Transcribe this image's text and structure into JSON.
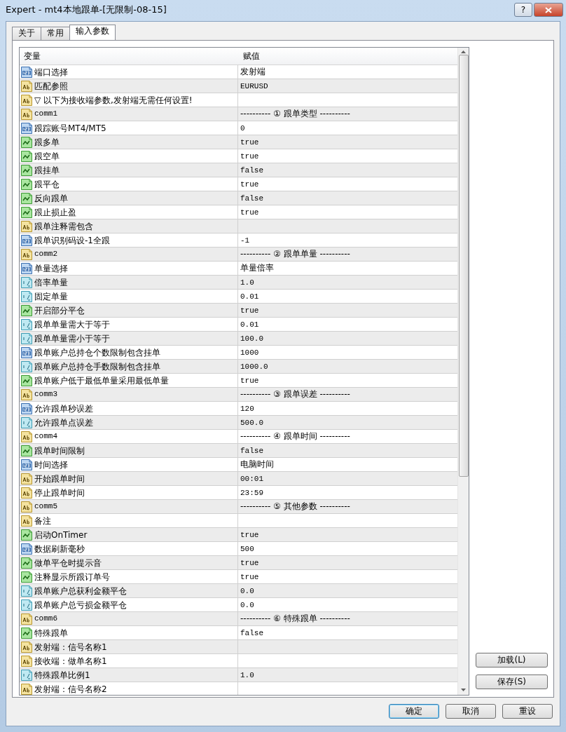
{
  "window": {
    "title": "Expert - mt4本地跟单-[无限制-08-15]",
    "help_button": "?"
  },
  "tabs": [
    {
      "label": "关于",
      "selected": false
    },
    {
      "label": "常用",
      "selected": false
    },
    {
      "label": "输入参数",
      "selected": true
    }
  ],
  "table": {
    "columns": [
      "变量",
      "赋值"
    ],
    "rows": [
      {
        "kind": "int",
        "variable": "端口选择",
        "value": "发射端"
      },
      {
        "kind": "string",
        "variable": "匹配参照",
        "value": "EURUSD"
      },
      {
        "kind": "string",
        "variable": "▽ 以下为接收端参数,发射端无需任何设置!",
        "value": ""
      },
      {
        "kind": "string",
        "variable": "comm1",
        "value": "---------- ① 跟单类型 ----------"
      },
      {
        "kind": "int",
        "variable": "跟踪账号MT4/MT5",
        "value": "0"
      },
      {
        "kind": "bool",
        "variable": "跟多单",
        "value": "true"
      },
      {
        "kind": "bool",
        "variable": "跟空单",
        "value": "true"
      },
      {
        "kind": "bool",
        "variable": "跟挂单",
        "value": "false"
      },
      {
        "kind": "bool",
        "variable": "跟平仓",
        "value": "true"
      },
      {
        "kind": "bool",
        "variable": "反向跟单",
        "value": "false"
      },
      {
        "kind": "bool",
        "variable": "跟止损止盈",
        "value": "true"
      },
      {
        "kind": "string",
        "variable": "跟单注释需包含",
        "value": ""
      },
      {
        "kind": "int",
        "variable": "跟单识别码设-1全跟",
        "value": "-1"
      },
      {
        "kind": "string",
        "variable": "comm2",
        "value": "---------- ② 跟单单量 ----------"
      },
      {
        "kind": "int",
        "variable": "单量选择",
        "value": "单量倍率"
      },
      {
        "kind": "double",
        "variable": "倍率单量",
        "value": "1.0"
      },
      {
        "kind": "double",
        "variable": "固定单量",
        "value": "0.01"
      },
      {
        "kind": "bool",
        "variable": "开启部分平仓",
        "value": "true"
      },
      {
        "kind": "double",
        "variable": "跟单单量需大于等于",
        "value": "0.01"
      },
      {
        "kind": "double",
        "variable": "跟单单量需小于等于",
        "value": "100.0"
      },
      {
        "kind": "int",
        "variable": "跟单账户总持仓个数限制包含挂单",
        "value": "1000"
      },
      {
        "kind": "double",
        "variable": "跟单账户总持仓手数限制包含挂单",
        "value": "1000.0"
      },
      {
        "kind": "bool",
        "variable": "跟单账户低于最低单量采用最低单量",
        "value": "true"
      },
      {
        "kind": "string",
        "variable": "comm3",
        "value": "---------- ③ 跟单误差 ----------"
      },
      {
        "kind": "int",
        "variable": "允许跟单秒误差",
        "value": "120"
      },
      {
        "kind": "double",
        "variable": "允许跟单点误差",
        "value": "500.0"
      },
      {
        "kind": "string",
        "variable": "comm4",
        "value": "---------- ④ 跟单时间 ----------"
      },
      {
        "kind": "bool",
        "variable": "跟单时间限制",
        "value": "false"
      },
      {
        "kind": "int",
        "variable": "时间选择",
        "value": "电脑时间"
      },
      {
        "kind": "string",
        "variable": "开始跟单时间",
        "value": "00:01"
      },
      {
        "kind": "string",
        "variable": "停止跟单时间",
        "value": "23:59"
      },
      {
        "kind": "string",
        "variable": "comm5",
        "value": "---------- ⑤ 其他参数 ----------"
      },
      {
        "kind": "string",
        "variable": "备注",
        "value": ""
      },
      {
        "kind": "bool",
        "variable": "启动OnTimer",
        "value": "true"
      },
      {
        "kind": "int",
        "variable": "数据刷新毫秒",
        "value": "500"
      },
      {
        "kind": "bool",
        "variable": "做单平仓时提示音",
        "value": "true"
      },
      {
        "kind": "bool",
        "variable": "注释显示所跟订单号",
        "value": "true"
      },
      {
        "kind": "double",
        "variable": "跟单账户总获利金额平仓",
        "value": "0.0"
      },
      {
        "kind": "double",
        "variable": "跟单账户总亏损金额平仓",
        "value": "0.0"
      },
      {
        "kind": "string",
        "variable": "comm6",
        "value": "---------- ⑥ 特殊跟单 ----------"
      },
      {
        "kind": "bool",
        "variable": "特殊跟单",
        "value": "false"
      },
      {
        "kind": "string",
        "variable": "发射端：信号名称1",
        "value": ""
      },
      {
        "kind": "string",
        "variable": "接收端：做单名称1",
        "value": ""
      },
      {
        "kind": "double",
        "variable": "特殊跟单比例1",
        "value": "1.0"
      },
      {
        "kind": "string",
        "variable": "发射端：信号名称2",
        "value": ""
      }
    ]
  },
  "side_buttons": [
    "加载(L)",
    "保存(S)"
  ],
  "buttons": [
    {
      "label": "确定",
      "default": true
    },
    {
      "label": "取消",
      "default": false
    },
    {
      "label": "重设",
      "default": false
    }
  ]
}
